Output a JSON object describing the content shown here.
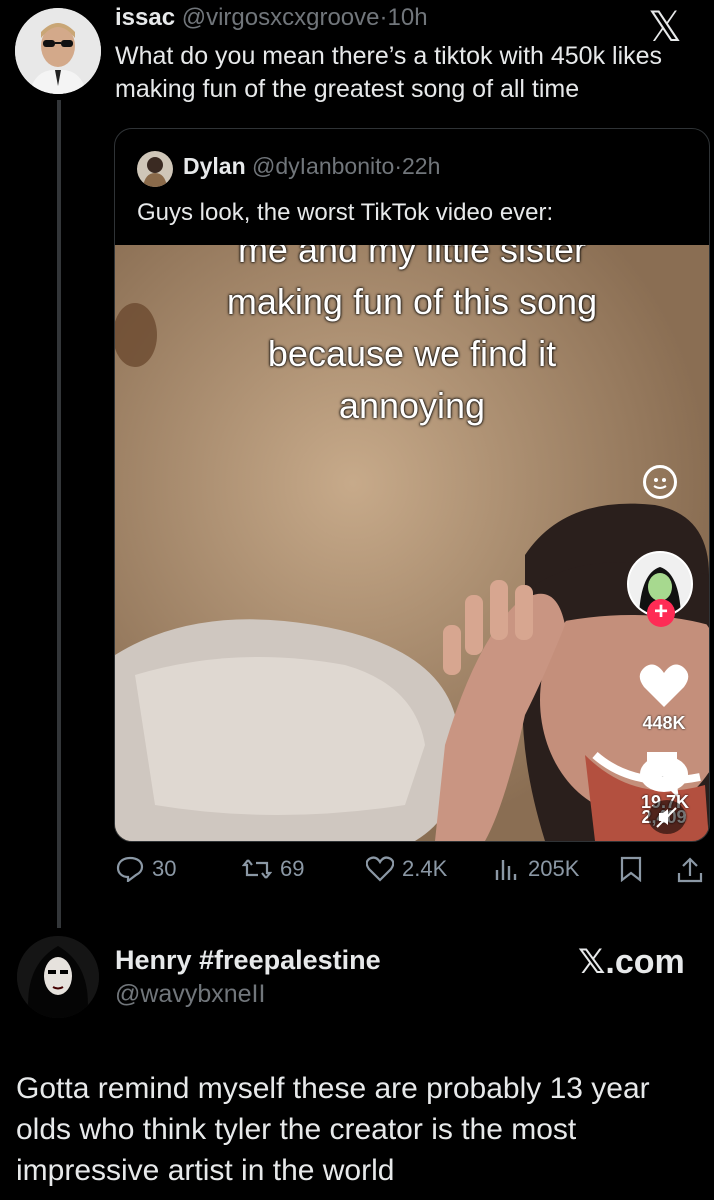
{
  "tweet": {
    "name": "issac",
    "handle": "@virgosxcxgroove",
    "time": "10h",
    "text": "What do you mean there’s a tiktok with 450k likes making fun of the greatest song of all time"
  },
  "quote": {
    "name": "Dylan",
    "handle": "@dyIanbonito",
    "time": "22h",
    "text": "Guys look, the worst TikTok video ever:",
    "video": {
      "caption_lines": [
        "me and my little sister",
        "making fun of this song",
        "because we find it",
        "annoying"
      ],
      "likes": "448K",
      "comments": "2,409",
      "saves": "19.7K"
    }
  },
  "actions": {
    "replies": "30",
    "reposts": "69",
    "likes": "2.4K",
    "views": "205K"
  },
  "reply": {
    "name": "Henry #freepalestine",
    "handle": "@wavybxneII",
    "text": "Gotta remind myself these are probably 13 year olds who think tyler the creator is the most impressive artist in the world"
  },
  "brand": {
    "x_logo": "𝕏",
    "watermark": "𝕏.com"
  },
  "colors": {
    "background": "#000000",
    "text": "#e7e9ea",
    "muted": "#71767b",
    "tiktok_red": "#fe2c55"
  }
}
